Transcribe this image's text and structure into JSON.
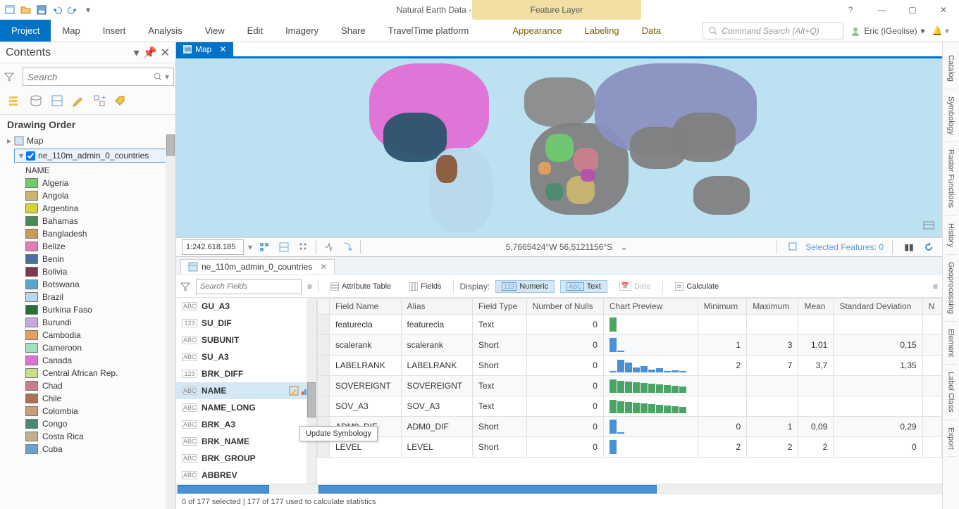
{
  "title": "Natural Earth Data - Map - ArcGIS Pro",
  "context_group_label": "Feature Layer",
  "ribbon_tabs": [
    "Project",
    "Map",
    "Insert",
    "Analysis",
    "View",
    "Edit",
    "Imagery",
    "Share",
    "TravelTime platform"
  ],
  "ribbon_context_tabs": [
    "Appearance",
    "Labeling",
    "Data"
  ],
  "command_search_placeholder": "Command Search (Alt+Q)",
  "user_label": "Eric (iGeolise)",
  "contents": {
    "title": "Contents",
    "search_placeholder": "Search",
    "drawing_order": "Drawing Order",
    "map_node": "Map",
    "layer_name": "ne_110m_admin_0_countries",
    "symbology_field": "NAME",
    "legend": [
      {
        "name": "Algeria",
        "color": "#6fc96f"
      },
      {
        "name": "Angola",
        "color": "#c9b56f"
      },
      {
        "name": "Argentina",
        "color": "#d6d23a"
      },
      {
        "name": "Bahamas",
        "color": "#4a8a54"
      },
      {
        "name": "Bangladesh",
        "color": "#c99a5a"
      },
      {
        "name": "Belize",
        "color": "#e07fb6"
      },
      {
        "name": "Benin",
        "color": "#4a6fa0"
      },
      {
        "name": "Bolivia",
        "color": "#7b3a4a"
      },
      {
        "name": "Botswana",
        "color": "#5aa7c9"
      },
      {
        "name": "Brazil",
        "color": "#b8d8ec"
      },
      {
        "name": "Burkina Faso",
        "color": "#2a6e3a"
      },
      {
        "name": "Burundi",
        "color": "#c9a7e0"
      },
      {
        "name": "Cambodia",
        "color": "#e0a060"
      },
      {
        "name": "Cameroon",
        "color": "#a0e0c0"
      },
      {
        "name": "Canada",
        "color": "#e26fd6"
      },
      {
        "name": "Central African Rep.",
        "color": "#c6e08a"
      },
      {
        "name": "Chad",
        "color": "#c97f8a"
      },
      {
        "name": "Chile",
        "color": "#ad6f5a"
      },
      {
        "name": "Colombia",
        "color": "#c99f7a"
      },
      {
        "name": "Congo",
        "color": "#4a8a70"
      },
      {
        "name": "Costa Rica",
        "color": "#c0b090"
      },
      {
        "name": "Cuba",
        "color": "#6aa0d6"
      }
    ]
  },
  "map_tab": {
    "label": "Map"
  },
  "map_status": {
    "scale": "1:242.618.185",
    "coords": "5,7665424°W 56,5121156°S",
    "selected_label": "Selected Features: 0"
  },
  "attribute_tab_label": "ne_110m_admin_0_countries",
  "attribute_toolbar": {
    "search_placeholder": "Search Fields",
    "attribute_table": "Attribute Table",
    "fields": "Fields",
    "display": "Display:",
    "numeric": "Numeric",
    "text": "Text",
    "date": "Date",
    "calculate": "Calculate"
  },
  "field_list": [
    {
      "type": "ABC",
      "name": "GU_A3"
    },
    {
      "type": "123",
      "name": "SU_DIF"
    },
    {
      "type": "ABC",
      "name": "SUBUNIT"
    },
    {
      "type": "ABC",
      "name": "SU_A3"
    },
    {
      "type": "123",
      "name": "BRK_DIFF"
    },
    {
      "type": "ABC",
      "name": "NAME",
      "selected": true
    },
    {
      "type": "ABC",
      "name": "NAME_LONG"
    },
    {
      "type": "ABC",
      "name": "BRK_A3"
    },
    {
      "type": "ABC",
      "name": "BRK_NAME"
    },
    {
      "type": "ABC",
      "name": "BRK_GROUP"
    },
    {
      "type": "ABC",
      "name": "ABBREV"
    }
  ],
  "stats_table": {
    "columns": [
      "Field Name",
      "Alias",
      "Field Type",
      "Number of Nulls",
      "Chart Preview",
      "Minimum",
      "Maximum",
      "Mean",
      "Standard Deviation"
    ],
    "rows": [
      {
        "field": "featurecla",
        "alias": "featurecla",
        "type": "Text",
        "nulls": 0,
        "chart": [
          100
        ],
        "min": "",
        "max": "",
        "mean": "",
        "std": "",
        "color": "green"
      },
      {
        "field": "scalerank",
        "alias": "scalerank",
        "type": "Short",
        "nulls": 0,
        "chart": [
          100,
          8
        ],
        "min": "1",
        "max": "3",
        "mean": "1,01",
        "std": "0,15",
        "color": "blue"
      },
      {
        "field": "LABELRANK",
        "alias": "LABELRANK",
        "type": "Short",
        "nulls": 0,
        "chart": [
          10,
          90,
          70,
          35,
          45,
          20,
          30,
          5,
          15,
          10
        ],
        "min": "2",
        "max": "7",
        "mean": "3,7",
        "std": "1,35",
        "color": "blue"
      },
      {
        "field": "SOVEREIGNT",
        "alias": "SOVEREIGNT",
        "type": "Text",
        "nulls": 0,
        "chart": [
          95,
          85,
          80,
          75,
          70,
          65,
          60,
          55,
          50,
          45
        ],
        "min": "",
        "max": "",
        "mean": "",
        "std": "",
        "color": "green"
      },
      {
        "field": "SOV_A3",
        "alias": "SOV_A3",
        "type": "Text",
        "nulls": 0,
        "chart": [
          95,
          85,
          80,
          75,
          70,
          65,
          60,
          55,
          50,
          45
        ],
        "min": "",
        "max": "",
        "mean": "",
        "std": "",
        "color": "green"
      },
      {
        "field": "ADM0_DIF",
        "alias": "ADM0_DIF",
        "type": "Short",
        "nulls": 0,
        "chart": [
          100,
          6
        ],
        "min": "0",
        "max": "1",
        "mean": "0,09",
        "std": "0,29",
        "color": "blue"
      },
      {
        "field": "LEVEL",
        "alias": "LEVEL",
        "type": "Short",
        "nulls": 0,
        "chart": [
          100
        ],
        "min": "2",
        "max": "2",
        "mean": "2",
        "std": "0",
        "color": "blue"
      }
    ]
  },
  "tooltip_text": "Update Symbology",
  "attr_status": "0 of 177 selected | 177 of 177 used to calculate statistics",
  "right_dock": [
    "Catalog",
    "Symbology",
    "Raster Functions",
    "History",
    "Geoprocessing",
    "Element",
    "Label Class",
    "Export"
  ]
}
